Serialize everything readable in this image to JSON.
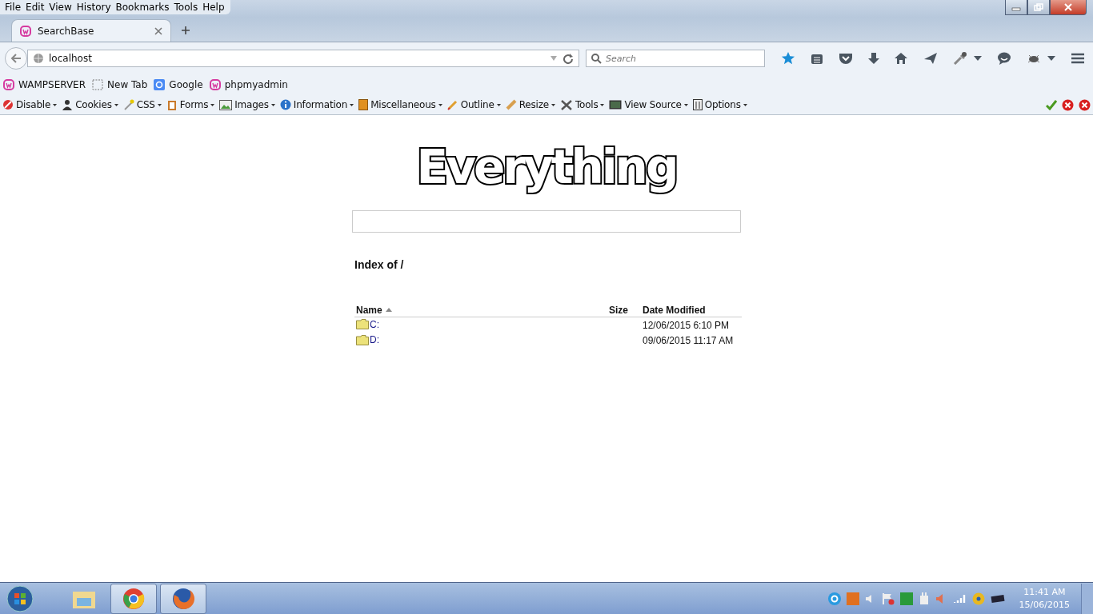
{
  "menu_bar": [
    "File",
    "Edit",
    "View",
    "History",
    "Bookmarks",
    "Tools",
    "Help"
  ],
  "tabs": [
    {
      "label": "SearchBase",
      "selected": true
    }
  ],
  "address_bar": {
    "value": "localhost"
  },
  "search_box": {
    "placeholder": "Search"
  },
  "bookmarks": [
    {
      "label": "WAMPSERVER",
      "kind": "wamp"
    },
    {
      "label": "New Tab",
      "kind": "blank"
    },
    {
      "label": "Google",
      "kind": "google"
    },
    {
      "label": "phpmyadmin",
      "kind": "wamp"
    }
  ],
  "developer_toolbar": [
    "Disable",
    "Cookies",
    "CSS",
    "Forms",
    "Images",
    "Information",
    "Miscellaneous",
    "Outline",
    "Resize",
    "Tools",
    "View Source",
    "Options"
  ],
  "page": {
    "logo": "Everything",
    "heading": "Index of /",
    "columns": [
      {
        "label": "Name",
        "sorted": true
      },
      {
        "label": "Size",
        "sorted": false
      },
      {
        "label": "Date Modified",
        "sorted": false
      }
    ],
    "rows": [
      {
        "name": "C:",
        "date_modified": "12/06/2015 6:10 PM"
      },
      {
        "name": "D:",
        "date_modified": "09/06/2015 11:17 AM"
      }
    ]
  },
  "taskbar": {
    "time": "11:41 AM",
    "date": "15/06/2015"
  }
}
